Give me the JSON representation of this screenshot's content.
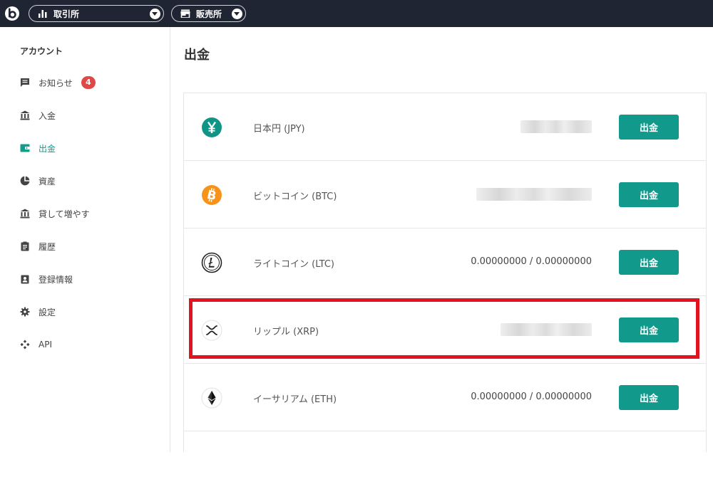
{
  "header": {
    "exchange_label": "取引所",
    "store_label": "販売所"
  },
  "sidebar": {
    "heading": "アカウント",
    "items": [
      {
        "label": "お知らせ",
        "badge": "4"
      },
      {
        "label": "入金"
      },
      {
        "label": "出金"
      },
      {
        "label": "資産"
      },
      {
        "label": "貸して増やす"
      },
      {
        "label": "履歴"
      },
      {
        "label": "登録情報"
      },
      {
        "label": "設定"
      },
      {
        "label": "API"
      }
    ],
    "active_item": "出金"
  },
  "main": {
    "title": "出金",
    "rows": [
      {
        "name": "日本円 (JPY)",
        "balance": "",
        "balance_hidden": true,
        "button": "出金",
        "icon": "yen-icon",
        "color": "#0f9585"
      },
      {
        "name": "ビットコイン (BTC)",
        "balance": "",
        "balance_hidden": true,
        "button": "出金",
        "icon": "bitcoin-icon",
        "color": "#f7931a"
      },
      {
        "name": "ライトコイン (LTC)",
        "balance": "0.00000000 / 0.00000000",
        "balance_hidden": false,
        "button": "出金",
        "icon": "litecoin-icon",
        "color": "#222222"
      },
      {
        "name": "リップル (XRP)",
        "balance": "",
        "balance_hidden": true,
        "button": "出金",
        "icon": "ripple-icon",
        "color": "#222222",
        "highlighted": true
      },
      {
        "name": "イーサリアム (ETH)",
        "balance": "0.00000000 / 0.00000000",
        "balance_hidden": false,
        "button": "出金",
        "icon": "ethereum-icon",
        "color": "#222222"
      }
    ]
  },
  "colors": {
    "topbar": "#1f2533",
    "accent": "#11998c",
    "highlight": "#e0141e",
    "badge": "#e04747"
  }
}
